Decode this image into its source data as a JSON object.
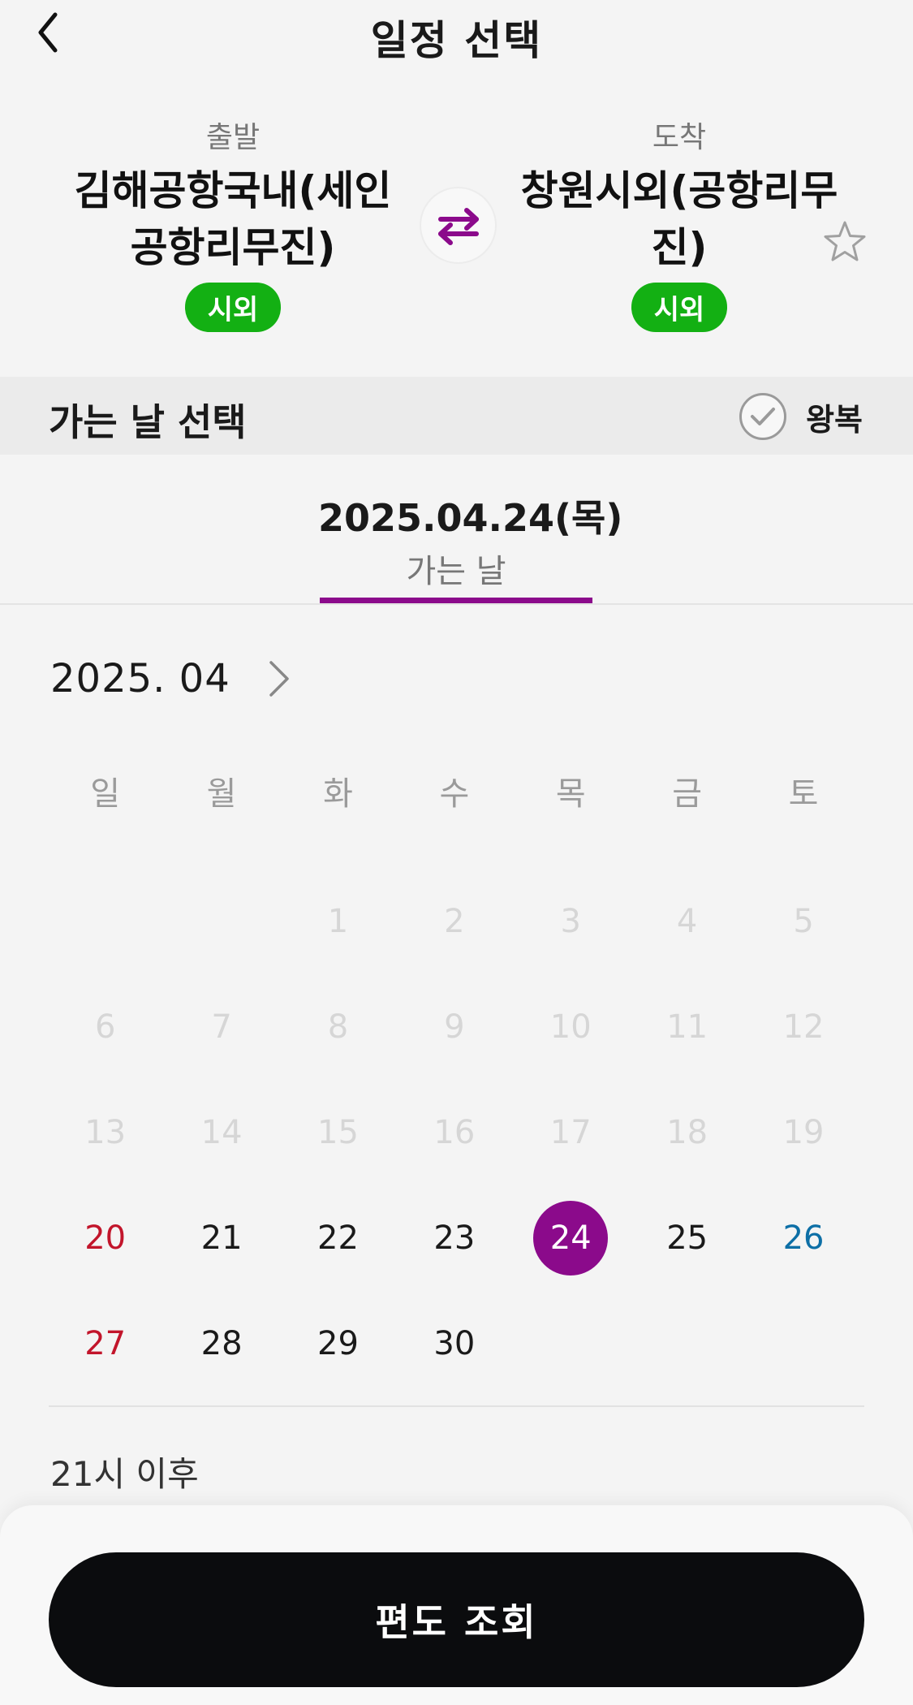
{
  "header": {
    "title": "일정 선택",
    "back_icon": "chevron-left-icon"
  },
  "route": {
    "departure": {
      "label": "출발",
      "name": "김해공항국내(세인\n공항리무진)",
      "badge": "시외"
    },
    "arrival": {
      "label": "도착",
      "name": "창원시외(공항리무\n진)",
      "badge": "시외"
    },
    "swap_icon": "swap-arrows-icon",
    "favorite_icon": "star-icon",
    "badge_color": "#13b013",
    "accent_color": "#8b0a8b"
  },
  "section": {
    "title": "가는 날 선택",
    "roundtrip_label": "왕복",
    "roundtrip_checked": false
  },
  "date_tab": {
    "value": "2025.04.24(목)",
    "label": "가는 날"
  },
  "calendar": {
    "month": "2025. 04",
    "weekdays": [
      "일",
      "월",
      "화",
      "수",
      "목",
      "금",
      "토"
    ],
    "weeks": [
      [
        "",
        "",
        "1",
        "2",
        "3",
        "4",
        "5"
      ],
      [
        "6",
        "7",
        "8",
        "9",
        "10",
        "11",
        "12"
      ],
      [
        "13",
        "14",
        "15",
        "16",
        "17",
        "18",
        "19"
      ],
      [
        "20",
        "21",
        "22",
        "23",
        "24",
        "25",
        "26"
      ],
      [
        "27",
        "28",
        "29",
        "30",
        "",
        "",
        ""
      ]
    ],
    "selected_day": "24",
    "disabled_through": 19,
    "sunday_color": "#c2152b",
    "saturday_color": "#0d6fa6"
  },
  "time_note": "21시 이후",
  "footer": {
    "search_label": "편도 조회"
  }
}
